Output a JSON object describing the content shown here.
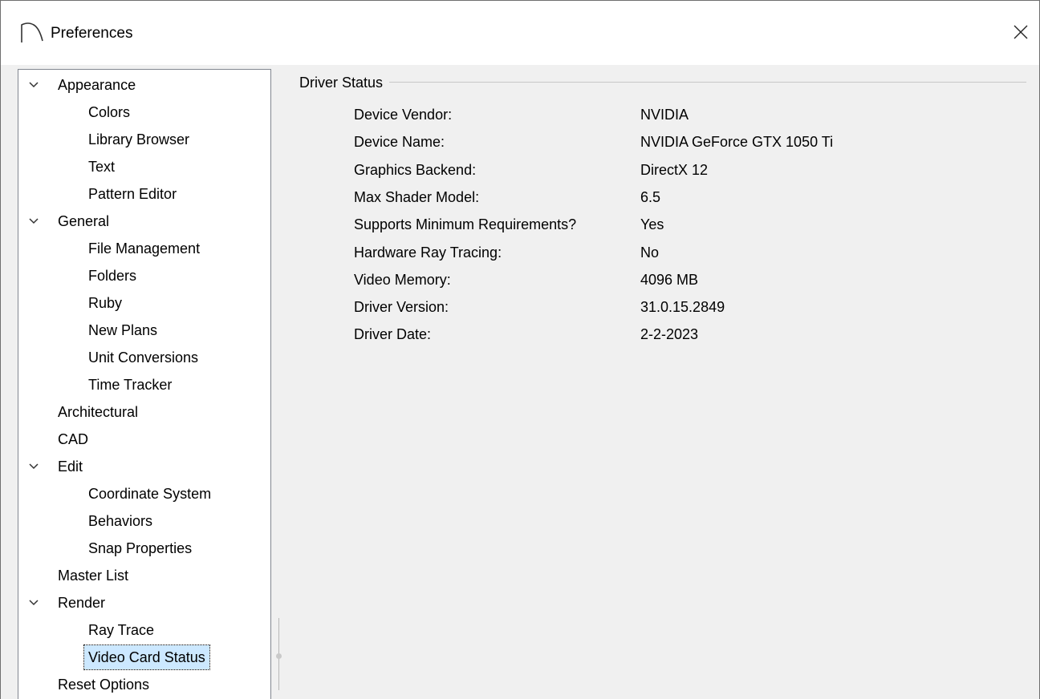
{
  "window": {
    "title": "Preferences"
  },
  "tree": {
    "items": [
      {
        "label": "Appearance",
        "level": 0,
        "expanded": true
      },
      {
        "label": "Colors",
        "level": 1
      },
      {
        "label": "Library Browser",
        "level": 1
      },
      {
        "label": "Text",
        "level": 1
      },
      {
        "label": "Pattern Editor",
        "level": 1
      },
      {
        "label": "General",
        "level": 0,
        "expanded": true
      },
      {
        "label": "File Management",
        "level": 1
      },
      {
        "label": "Folders",
        "level": 1
      },
      {
        "label": "Ruby",
        "level": 1
      },
      {
        "label": "New Plans",
        "level": 1
      },
      {
        "label": "Unit Conversions",
        "level": 1
      },
      {
        "label": "Time Tracker",
        "level": 1
      },
      {
        "label": "Architectural",
        "level": 0
      },
      {
        "label": "CAD",
        "level": 0
      },
      {
        "label": "Edit",
        "level": 0,
        "expanded": true
      },
      {
        "label": "Coordinate System",
        "level": 1
      },
      {
        "label": "Behaviors",
        "level": 1
      },
      {
        "label": "Snap Properties",
        "level": 1
      },
      {
        "label": "Master List",
        "level": 0
      },
      {
        "label": "Render",
        "level": 0,
        "expanded": true
      },
      {
        "label": "Ray Trace",
        "level": 1
      },
      {
        "label": "Video Card Status",
        "level": 1,
        "selected": true
      },
      {
        "label": "Reset Options",
        "level": 0
      }
    ]
  },
  "driver_status": {
    "heading": "Driver Status",
    "rows": [
      {
        "label": "Device Vendor:",
        "value": "NVIDIA"
      },
      {
        "label": "Device Name:",
        "value": "NVIDIA GeForce GTX 1050 Ti"
      },
      {
        "label": "Graphics Backend:",
        "value": "DirectX 12"
      },
      {
        "label": "Max Shader Model:",
        "value": "6.5"
      },
      {
        "label": "Supports Minimum Requirements?",
        "value": "Yes"
      },
      {
        "label": "Hardware Ray Tracing:",
        "value": "No"
      },
      {
        "label": "Video Memory:",
        "value": "4096 MB"
      },
      {
        "label": "Driver Version:",
        "value": "31.0.15.2849"
      },
      {
        "label": "Driver Date:",
        "value": "2-2-2023"
      }
    ]
  },
  "icons": {
    "app": "arch-logo-icon",
    "close": "close-icon",
    "expand": "chevron-down-icon"
  },
  "colors": {
    "selection": "#cce8ff",
    "border": "#828790"
  }
}
